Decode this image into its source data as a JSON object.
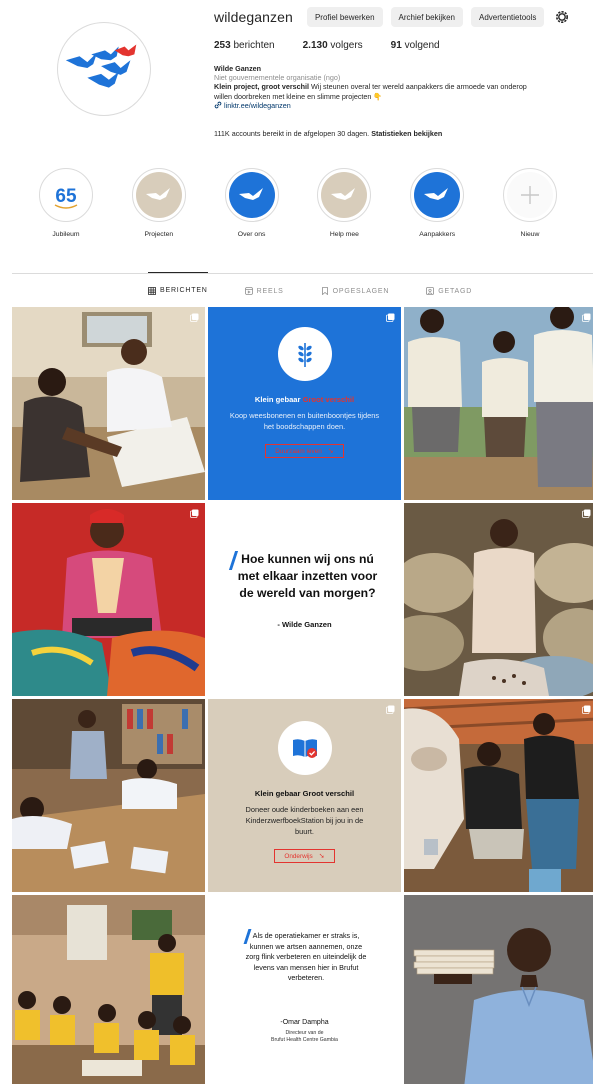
{
  "profile": {
    "username": "wildeganzen",
    "buttons": {
      "edit": "Profiel bewerken",
      "archive": "Archief bekijken",
      "ad_tools": "Advertentietools"
    },
    "stats": {
      "posts_count": "253",
      "posts_label": "berichten",
      "followers_count": "2.130",
      "followers_label": "volgers",
      "following_count": "91",
      "following_label": "volgend"
    },
    "bio": {
      "name": "Wilde Ganzen",
      "category": "Niet gouvernementele organisatie (ngo)",
      "line1_bold": "Klein project, groot verschil",
      "line1_rest": " Wij steunen overal ter wereld aanpakkers die armoede van onderop",
      "line2": "willen doorbreken met kleine en slimme projecten 👇",
      "link": "linktr.ee/wildeganzen"
    },
    "insights": {
      "text": "111K accounts bereikt in de afgelopen 30 dagen. ",
      "link": "Statistieken bekijken"
    }
  },
  "highlights": [
    {
      "label": "Jubileum",
      "icon": "jubileum-65-icon"
    },
    {
      "label": "Projecten",
      "icon": "goose-icon"
    },
    {
      "label": "Over ons",
      "icon": "goose-icon"
    },
    {
      "label": "Help mee",
      "icon": "goose-icon"
    },
    {
      "label": "Aanpakkers",
      "icon": "goose-icon"
    },
    {
      "label": "Nieuw",
      "icon": "plus-icon"
    }
  ],
  "jubileum_badge": "65",
  "tabs": [
    {
      "label": "BERICHTEN",
      "icon": "grid-icon"
    },
    {
      "label": "REELS",
      "icon": "reels-icon"
    },
    {
      "label": "OPGESLAGEN",
      "icon": "bookmark-icon"
    },
    {
      "label": "GETAGD",
      "icon": "tag-icon"
    }
  ],
  "posts": {
    "card1": {
      "title_a": "Klein gebaar ",
      "title_b": "Groot verschil",
      "text": "Koop weesbonenen en buitenboontjes tijdens het boodschappen doen.",
      "button": "Duurzaam leven"
    },
    "quote1": {
      "text": "Hoe kunnen wij ons nú met elkaar inzetten voor de wereld van morgen?",
      "author": "- Wilde Ganzen"
    },
    "card2": {
      "title": "Klein gebaar Groot verschil",
      "text": "Doneer oude kinderboeken aan een KinderzwerfboekStation bij jou in de buurt.",
      "button": "Onderwijs"
    },
    "quote2": {
      "text": "Als de operatiekamer er straks is, kunnen we artsen aannemen, onze zorg flink verbeteren en uiteindelijk de levens van mensen hier in Brufut verbeteren.",
      "author": "-Omar Dampha",
      "sub1": "Directeur van de",
      "sub2": "Brufut Health Centre Gambia"
    }
  },
  "colors": {
    "accent_blue": "#1e73d8",
    "accent_red": "#e3342f",
    "beige": "#d8cdbb",
    "divider": "#dbdbdb"
  }
}
